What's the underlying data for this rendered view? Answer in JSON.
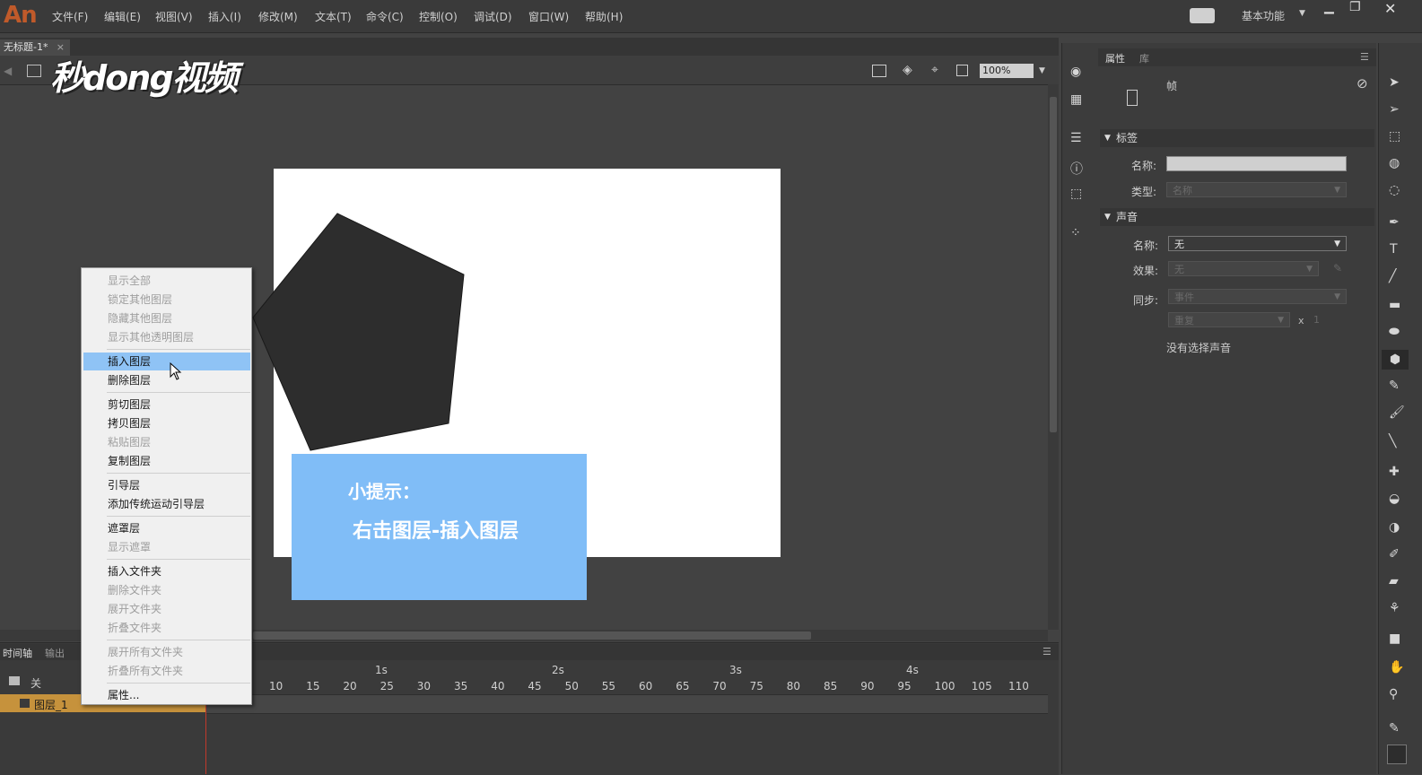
{
  "app": {
    "logo": "An"
  },
  "menu": [
    "文件(F)",
    "编辑(E)",
    "视图(V)",
    "插入(I)",
    "修改(M)",
    "文本(T)",
    "命令(C)",
    "控制(O)",
    "调试(D)",
    "窗口(W)",
    "帮助(H)"
  ],
  "workspace": "基本功能",
  "document": {
    "tab": "无标题-1*"
  },
  "watermark": "秒dong视频",
  "zoom": "100%",
  "tip": {
    "title": "小提示：",
    "body": "右击图层-插入图层"
  },
  "context_menu": [
    {
      "label": "显示全部",
      "enabled": false
    },
    {
      "label": "锁定其他图层",
      "enabled": false
    },
    {
      "label": "隐藏其他图层",
      "enabled": false
    },
    {
      "label": "显示其他透明图层",
      "enabled": false
    },
    {
      "label": "插入图层",
      "enabled": true,
      "hover": true
    },
    {
      "label": "删除图层",
      "enabled": true
    },
    {
      "label": "剪切图层",
      "enabled": true
    },
    {
      "label": "拷贝图层",
      "enabled": true
    },
    {
      "label": "粘贴图层",
      "enabled": false
    },
    {
      "label": "复制图层",
      "enabled": true
    },
    {
      "label": "引导层",
      "enabled": true
    },
    {
      "label": "添加传统运动引导层",
      "enabled": true
    },
    {
      "label": "遮罩层",
      "enabled": true
    },
    {
      "label": "显示遮罩",
      "enabled": false
    },
    {
      "label": "插入文件夹",
      "enabled": true
    },
    {
      "label": "删除文件夹",
      "enabled": false
    },
    {
      "label": "展开文件夹",
      "enabled": false
    },
    {
      "label": "折叠文件夹",
      "enabled": false
    },
    {
      "label": "展开所有文件夹",
      "enabled": false
    },
    {
      "label": "折叠所有文件夹",
      "enabled": false
    },
    {
      "label": "属性...",
      "enabled": true
    }
  ],
  "timeline": {
    "tabs": [
      "时间轴",
      "输出"
    ],
    "layer_header": "关",
    "layer": "图层_1",
    "seconds": [
      "1s",
      "2s",
      "3s",
      "4s"
    ],
    "frame_numbers": [
      "10",
      "15",
      "20",
      "25",
      "30",
      "35",
      "40",
      "45",
      "50",
      "55",
      "60",
      "65",
      "70",
      "75",
      "80",
      "85",
      "90",
      "95",
      "100",
      "105",
      "110"
    ]
  },
  "properties": {
    "tabs": [
      "属性",
      "库"
    ],
    "type": "帧",
    "label_section": "标签",
    "label_name": "名称:",
    "label_type": "类型:",
    "label_type_value": "名称",
    "sound_section": "声音",
    "sound_name_label": "名称:",
    "sound_name_value": "无",
    "effect_label": "效果:",
    "effect_value": "无",
    "sync_label": "同步:",
    "sync_value": "事件",
    "repeat_value": "重复",
    "repeat_x": "x",
    "repeat_count": "1",
    "no_sound": "没有选择声音"
  }
}
